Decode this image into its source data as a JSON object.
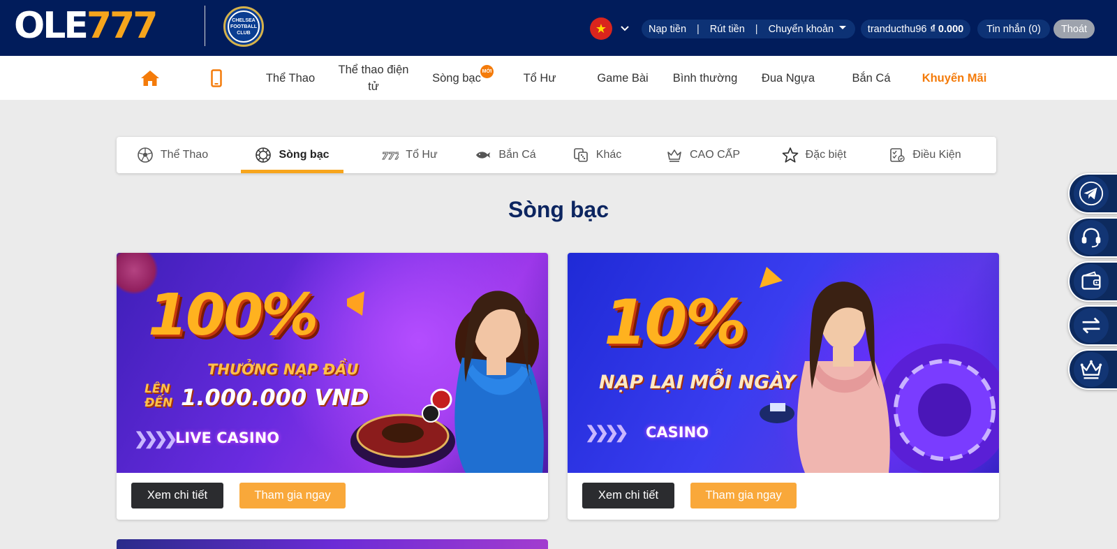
{
  "brand": {
    "logo_white": "OLE",
    "logo_orange": "777",
    "partner_badge_text": "CHELSEA FOOTBALL CLUB"
  },
  "header": {
    "language_flag": "★",
    "deposit": "Nạp tiền",
    "withdraw": "Rút tiền",
    "transfer": "Chuyển khoản",
    "username": "tranducthu96",
    "balance": "₫ 0.000",
    "messages": "Tin nhắn (0)",
    "logout": "Thoát"
  },
  "nav": {
    "items": [
      "Thể Thao",
      "Thể thao điện tử",
      "Sòng bạc",
      "Tổ Hư",
      "Game Bài",
      "Bình thường",
      "Đua Ngựa",
      "Bắn Cá",
      "Khuyến Mãi"
    ],
    "new_badge": "MỚI"
  },
  "tabs": [
    "Thể Thao",
    "Sòng bạc",
    "Tổ Hư",
    "Bắn Cá",
    "Khác",
    "CAO CẤP",
    "Đặc biệt",
    "Điều Kiện"
  ],
  "section_title": "Sòng bạc",
  "promos": [
    {
      "percent": "100%",
      "line1": "THƯỞNG NẠP ĐẦU",
      "line2_small_a": "LÊN",
      "line2_small_b": "ĐẾN",
      "line2_amount": "1.000.000 VND",
      "tag": "LIVE CASINO",
      "details_label": "Xem chi tiết",
      "join_label": "Tham gia ngay"
    },
    {
      "percent": "10%",
      "line1": "NẠP LẠI MỖI NGÀY",
      "tag": "CASINO",
      "details_label": "Xem chi tiết",
      "join_label": "Tham gia ngay"
    }
  ],
  "side_buttons": [
    "telegram-icon",
    "headset-icon",
    "wallet-icon",
    "transfer-icon",
    "crown-icon"
  ],
  "colors": {
    "header_bg": "#011c5b",
    "accent_orange": "#f47b0a",
    "tab_underline": "#f7a51c",
    "title_navy": "#0c2560"
  }
}
